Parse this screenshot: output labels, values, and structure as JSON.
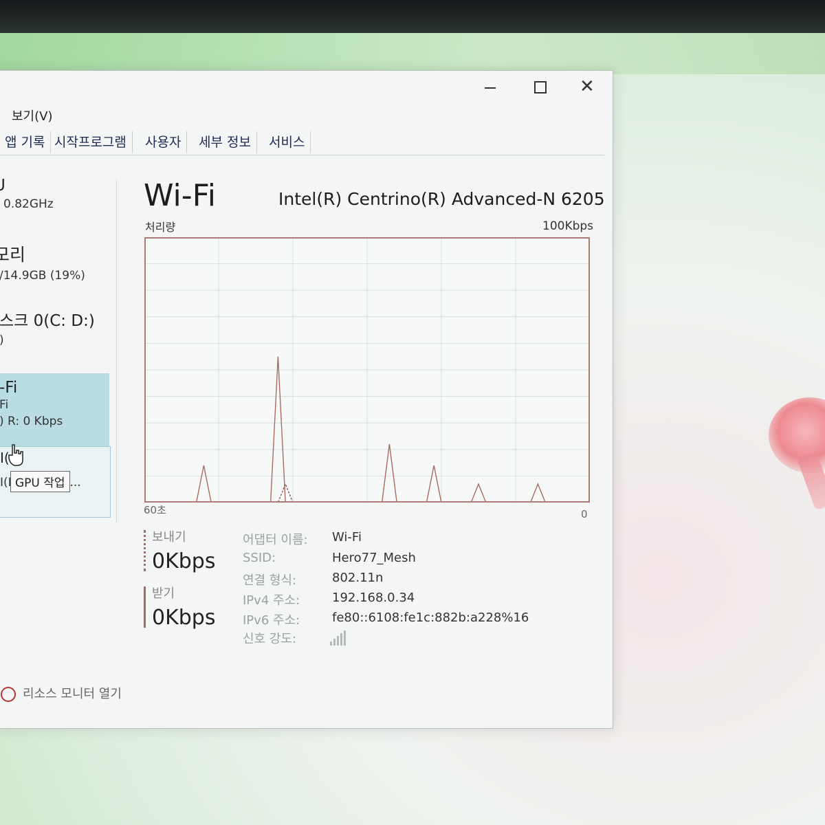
{
  "menu": {
    "view": "보기(V)"
  },
  "tabs": [
    "앱 기록",
    "시작프로그램",
    "사용자",
    "세부 정보",
    "서비스"
  ],
  "sidebar": {
    "cpu": {
      "name": "U",
      "sub": "0.82GHz"
    },
    "memory": {
      "name": "모리",
      "sub": "/14.9GB (19%)"
    },
    "disk": {
      "name": "스크 0(C: D:)",
      "sub": ")"
    },
    "wifi": {
      "name": "-Fi",
      "sub1": "Fi",
      "sub2": ") R: 0 Kbps"
    },
    "gpu": {
      "name": "I(",
      "sub": "I(F",
      "tooltip": "GPU 작업",
      "trail": "..."
    }
  },
  "header": {
    "title": "Wi-Fi",
    "adapter": "Intel(R) Centrino(R) Advanced-N 6205",
    "throughput_label": "처리량",
    "throughput_max": "100Kbps",
    "axis_left": "60초",
    "axis_right": "0"
  },
  "chart_data": {
    "type": "line",
    "title": "처리량",
    "xlabel": "",
    "ylabel": "",
    "x_range_seconds": [
      60,
      0
    ],
    "ylim": [
      0,
      100
    ],
    "y_unit": "Kbps",
    "grid": true,
    "series": [
      {
        "x": [
          60,
          53,
          52,
          51,
          50,
          43,
          42,
          41,
          40,
          28,
          27,
          26,
          25,
          22,
          21,
          20,
          19,
          16,
          15,
          14,
          13,
          8,
          7,
          6,
          5,
          0
        ],
        "y": [
          0,
          0,
          14,
          0,
          0,
          0,
          55,
          0,
          0,
          0,
          22,
          0,
          0,
          0,
          14,
          0,
          0,
          0,
          7,
          0,
          0,
          0,
          7,
          0,
          0,
          0
        ]
      },
      {
        "x": [
          60,
          42,
          41,
          40,
          0
        ],
        "y": [
          0,
          0,
          7,
          0,
          0
        ]
      }
    ],
    "colors": {
      "send": "#a86a62",
      "receive": "#8b5a52",
      "grid": "#d7e0dc",
      "border": "#b07a72"
    }
  },
  "stats": {
    "send_label": "보내기",
    "send_value": "0Kbps",
    "recv_label": "받기",
    "recv_value": "0Kbps"
  },
  "properties": [
    {
      "key": "어댑터 이름:",
      "value": "Wi-Fi"
    },
    {
      "key": "SSID:",
      "value": "Hero77_Mesh"
    },
    {
      "key": "연결 형식:",
      "value": "802.11n"
    },
    {
      "key": "IPv4 주소:",
      "value": "192.168.0.34"
    },
    {
      "key": "IPv6 주소:",
      "value": "fe80::6108:fe1c:882b:a228%16"
    },
    {
      "key": "신호 강도:",
      "value": ""
    }
  ],
  "footer": {
    "label": "리소스 모니터 열기"
  }
}
